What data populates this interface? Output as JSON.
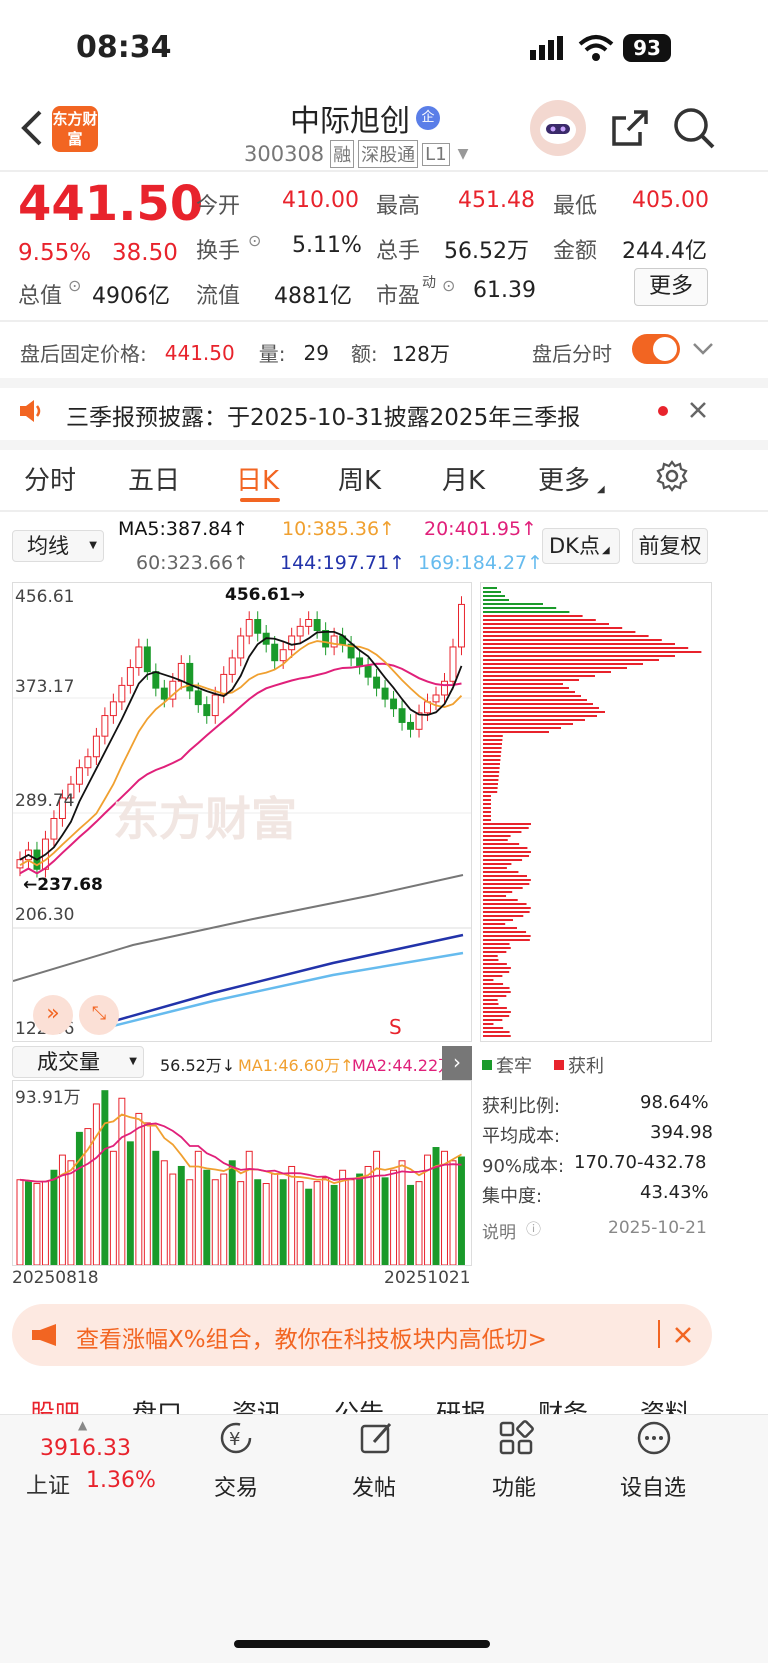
{
  "status": {
    "time": "08:34",
    "battery": "93"
  },
  "header": {
    "logo": "东方财富",
    "name": "中际旭创",
    "badge": "企",
    "code": "300308",
    "tags": [
      "融",
      "深股通",
      "L1"
    ]
  },
  "quote": {
    "price": "441.50",
    "pct": "9.55%",
    "chg": "38.50",
    "open_k": "今开",
    "open": "410.00",
    "high_k": "最高",
    "high": "451.48",
    "low_k": "最低",
    "low": "405.00",
    "turn_k": "换手",
    "turn": "5.11%",
    "vol_k": "总手",
    "vol": "56.52万",
    "amt_k": "金额",
    "amt": "244.4亿",
    "mcap_k": "总值",
    "mcap": "4906亿",
    "fcap_k": "流值",
    "fcap": "4881亿",
    "pe_k": "市盈",
    "pe_sup": "动",
    "pe": "61.39",
    "more": "更多"
  },
  "after": {
    "label": "盘后固定价格:",
    "price": "441.50",
    "vol_k": "量:",
    "vol": "29",
    "amt_k": "额:",
    "amt": "128万",
    "toggle_label": "盘后分时"
  },
  "notice": {
    "text": "三季报预披露：于2025-10-31披露2025年三季报"
  },
  "tabs": [
    "分时",
    "五日",
    "日K",
    "周K",
    "月K",
    "更多"
  ],
  "active_tab": "日K",
  "ma": {
    "select": "均线",
    "ma5": "MA5:387.84↑",
    "ma10": "10:385.36↑",
    "ma20": "20:401.95↑",
    "ma60": "60:323.66↑",
    "ma144": "144:197.71↑",
    "ma169": "169:184.27↑",
    "dk": "DK点",
    "fq": "前复权"
  },
  "colors": {
    "red": "#e8232c",
    "green": "#1a9a2a",
    "ma5": "#111111",
    "ma10": "#f0a030",
    "ma20": "#e0207a",
    "ma60": "#666666",
    "ma144": "#2233aa",
    "ma169": "#66bbee"
  },
  "kchart": {
    "y_top": "456.61",
    "y_mid": "373.17",
    "y_low": "289.74",
    "y_bot": "206.30",
    "y_lower": "122.86",
    "max_label": "456.61→",
    "min_label": "←237.68",
    "watermark": "东方财富",
    "signal": "S"
  },
  "volpanel": {
    "select": "成交量",
    "v": "56.52万↓",
    "ma1": "MA1:46.60万↑",
    "ma2": "MA2:44.22万↑",
    "ytop": "93.91万",
    "date_start": "20250818",
    "date_end": "20251021"
  },
  "chips": {
    "legend_hold": "套牢",
    "legend_profit": "获利",
    "rows": [
      {
        "k": "获利比例:",
        "v": "98.64%"
      },
      {
        "k": "平均成本:",
        "v": "394.98"
      },
      {
        "k": "90%成本:",
        "v": "170.70-432.78"
      },
      {
        "k": "集中度:",
        "v": "43.43%"
      }
    ],
    "note_k": "说明",
    "note_date": "2025-10-21"
  },
  "promo": {
    "text": "查看涨幅X%组合，教你在科技板块内高低切>"
  },
  "subtabs": [
    "股吧",
    "盘口",
    "资讯",
    "公告",
    "研报",
    "财务",
    "资料"
  ],
  "bottom": {
    "index_val": "3916.33",
    "index_name": "上证",
    "index_pct": "1.36%",
    "trade": "交易",
    "post": "发帖",
    "func": "功能",
    "watch": "设自选"
  },
  "chart_data": {
    "type": "candlestick",
    "title": "日K",
    "ylim": [
      122.86,
      456.61
    ],
    "y_ticks": [
      456.61,
      373.17,
      289.74,
      206.3,
      122.86
    ],
    "x_range": [
      "20250818",
      "20251021"
    ],
    "max": 456.61,
    "min": 237.68,
    "ma": {
      "MA5": 387.84,
      "MA10": 385.36,
      "MA20": 401.95,
      "MA60": 323.66,
      "MA144": 197.71,
      "MA169": 184.27
    },
    "volume": {
      "last": "56.52万",
      "MA1": "46.60万",
      "MA2": "44.22万",
      "ymax": "93.91万"
    }
  }
}
